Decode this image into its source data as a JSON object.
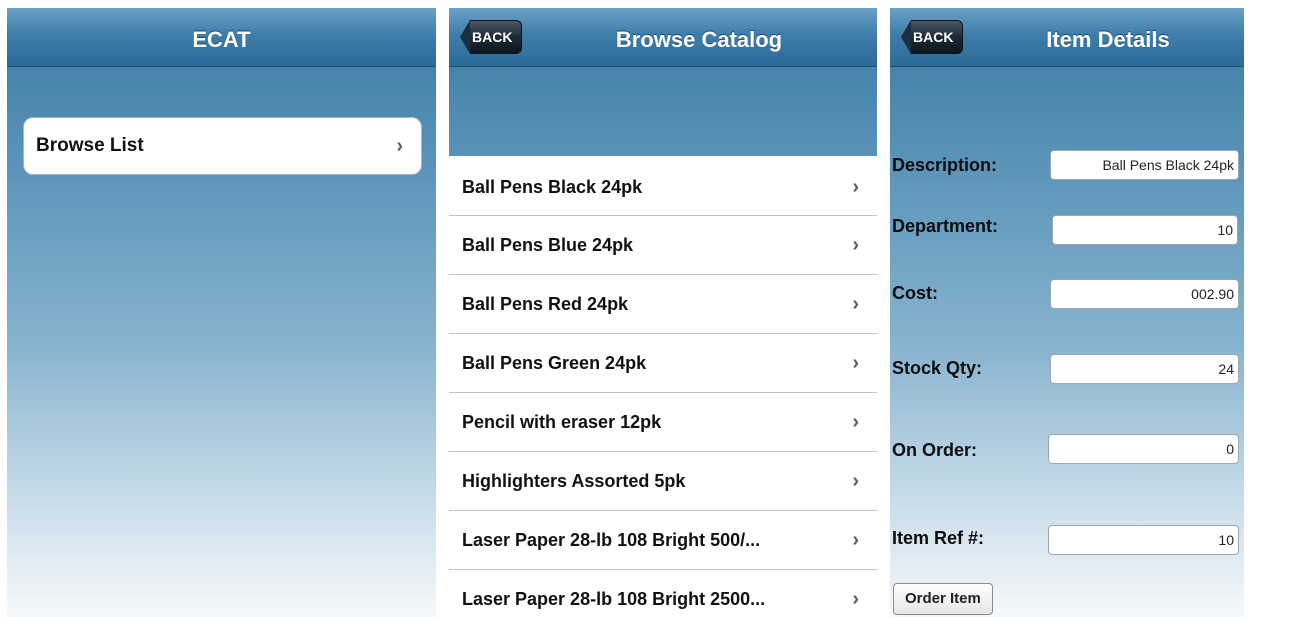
{
  "home": {
    "title": "ECAT",
    "items": [
      {
        "label": "Browse List"
      }
    ]
  },
  "catalog": {
    "back_label": "BACK",
    "title": "Browse Catalog",
    "items": [
      {
        "label": "Ball Pens Black 24pk"
      },
      {
        "label": "Ball Pens Blue 24pk"
      },
      {
        "label": "Ball Pens Red 24pk"
      },
      {
        "label": "Ball Pens Green 24pk"
      },
      {
        "label": "Pencil with eraser 12pk"
      },
      {
        "label": "Highlighters Assorted 5pk"
      },
      {
        "label": "Laser Paper 28-lb 108 Bright 500/..."
      },
      {
        "label": "Laser Paper 28-lb 108 Bright 2500..."
      }
    ]
  },
  "details": {
    "back_label": "BACK",
    "title": "Item Details",
    "fields": {
      "description": {
        "label": "Description:",
        "value": "Ball Pens Black 24pk"
      },
      "department": {
        "label": "Department:",
        "value": "10"
      },
      "cost": {
        "label": "Cost:",
        "value": "002.90"
      },
      "stock_qty": {
        "label": "Stock Qty:",
        "value": "24"
      },
      "on_order": {
        "label": "On Order:",
        "value": "0"
      },
      "item_ref": {
        "label": "Item Ref #:",
        "value": "10"
      }
    },
    "order_button": "Order Item"
  },
  "icons": {
    "chevron": "chevron-right-icon",
    "back": "back-arrow-button"
  },
  "colors": {
    "header": "#2c6b98",
    "back_button": "#1d2b38"
  }
}
